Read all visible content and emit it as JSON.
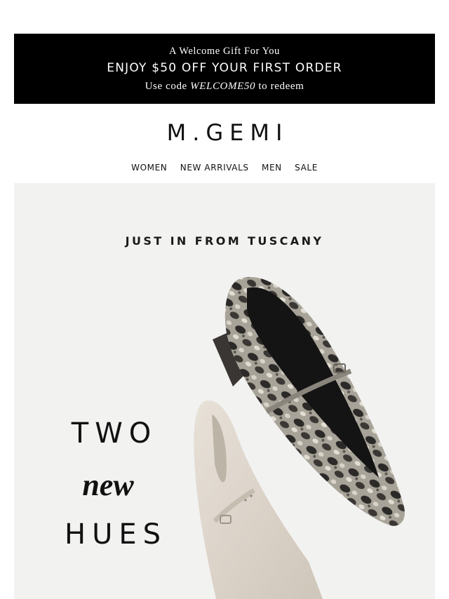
{
  "banner": {
    "line1": "A Welcome Gift For You",
    "line2": "ENJOY $50 OFF YOUR FIRST ORDER",
    "line3_prefix": "Use code ",
    "line3_code": "WELCOME50",
    "line3_suffix": " to redeem"
  },
  "brand": {
    "logo": "M.GEMI"
  },
  "nav": {
    "items": [
      "WOMEN",
      "NEW ARRIVALS",
      "MEN",
      "SALE"
    ]
  },
  "hero": {
    "kicker": "JUST IN FROM TUSCANY",
    "headline_top": "TWO",
    "headline_mid": "new",
    "headline_bottom": "HUES",
    "colors": {
      "background": "#f2f2f1",
      "snake_shoe": "#8f8a80",
      "cream_shoe": "#ddd5cb"
    }
  }
}
